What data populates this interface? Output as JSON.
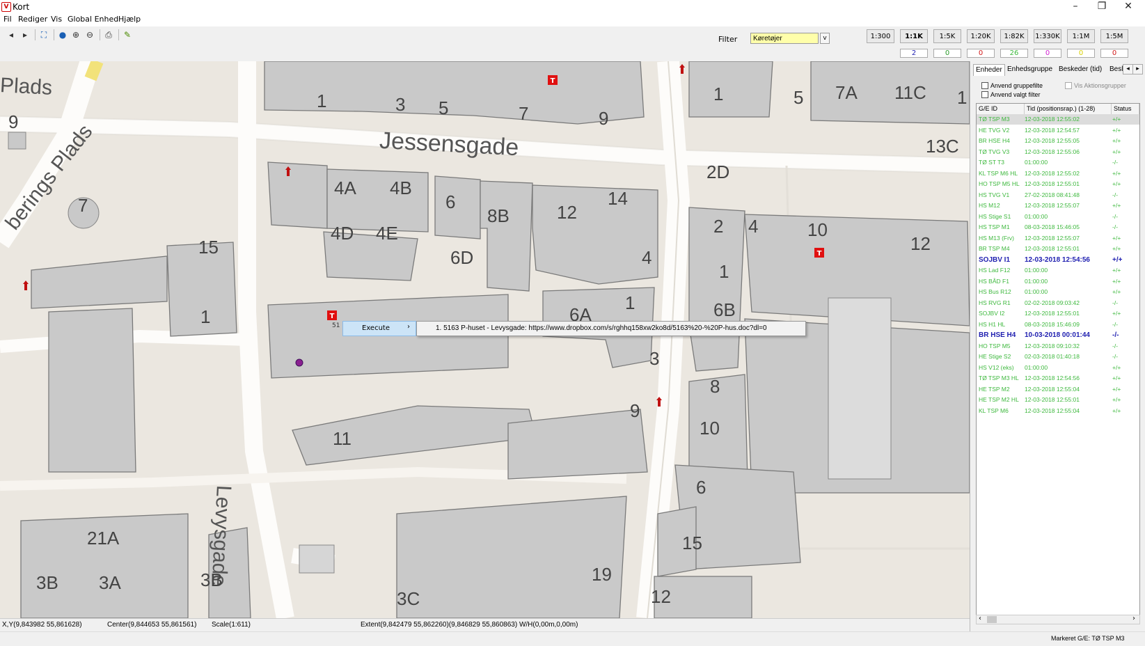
{
  "window": {
    "title": "Kort",
    "app_icon": "V",
    "controls": {
      "minimize": "–",
      "maximize": "❐",
      "close": "✕"
    }
  },
  "menu": [
    "Fil",
    "Rediger",
    "Vis",
    "Global Enhed",
    "Hjælp"
  ],
  "toolbar": {
    "icons": [
      "back-icon",
      "forward-icon",
      "layers-icon",
      "globe-icon",
      "zoom-in-icon",
      "zoom-out-icon",
      "print-icon",
      "ruler-icon"
    ],
    "glyphs": [
      "◂",
      "▸",
      "⛶",
      "●",
      "⊕",
      "⊖",
      "⎙",
      "✎"
    ]
  },
  "filter": {
    "label": "Filter",
    "value": "Køretøjer",
    "dropdown": "v"
  },
  "scales": [
    "1:300",
    "1:1K",
    "1:5K",
    "1:20K",
    "1:82K",
    "1:330K",
    "1:1M",
    "1:5M"
  ],
  "active_scale": "1:1K",
  "counts": [
    {
      "value": "2",
      "color": "#1f1fb0"
    },
    {
      "value": "0",
      "color": "#2a9a2a"
    },
    {
      "value": "0",
      "color": "#d01818"
    },
    {
      "value": "26",
      "color": "#3db83d"
    },
    {
      "value": "0",
      "color": "#d020d0"
    },
    {
      "value": "0",
      "color": "#d8d000"
    },
    {
      "value": "0",
      "color": "#d01818"
    }
  ],
  "map": {
    "streets": [
      "Jessensgade",
      "Levysgade",
      "berings Plads",
      "Plads"
    ],
    "house_numbers": [
      "1",
      "3",
      "5",
      "7",
      "9",
      "1",
      "5",
      "7A",
      "11C",
      "1",
      "13C",
      "9",
      "7",
      "2D",
      "4A",
      "4B",
      "6",
      "8B",
      "12",
      "14",
      "4D",
      "4E",
      "6D",
      "2",
      "4",
      "10",
      "12",
      "1",
      "15",
      "1",
      "4",
      "1",
      "6A",
      "6B",
      "3",
      "8",
      "9",
      "10",
      "11",
      "6",
      "15",
      "19",
      "12",
      "21A",
      "3B",
      "3A",
      "3B",
      "3C",
      "2"
    ],
    "marker_label": "T"
  },
  "context_menu": {
    "label": "Execute",
    "arrow": "›",
    "popup_prefix": "51",
    "submenu_item": "1. 5163 P-huset - Levysgade: https://www.dropbox.com/s/rghhq158xw2ko8d/5163%20-%20P-hus.doc?dl=0"
  },
  "status": {
    "xy": "X,Y(9,843982 55,861628)",
    "center": "Center(9,844653 55,861561)",
    "scale": "Scale(1:611)",
    "extent": "Extent(9,842479 55,862260)(9,846829 55,860863) W/H(0,00m,0,00m)"
  },
  "panel": {
    "tabs": [
      "Enheder",
      "Enhedsgruppe",
      "Beskeder (tid)",
      "Besl"
    ],
    "tab_nav": [
      "◂",
      "▸"
    ],
    "checkboxes": [
      "Anvend gruppefilte",
      "Anvend valgt filter"
    ],
    "aktion_checkbox": "Vis Aktionsgrupper",
    "columns": [
      "G/E ID",
      "Tid (positionsrap.) (1-28)",
      "Status"
    ],
    "rows": [
      {
        "id": "TØ TSP M3",
        "time": "12-03-2018 12:55:02",
        "status": "+/+",
        "style": "g",
        "selected": true
      },
      {
        "id": "HE TVG V2",
        "time": "12-03-2018 12:54:57",
        "status": "+/+",
        "style": "g"
      },
      {
        "id": "BR HSE H4",
        "time": "12-03-2018 12:55:05",
        "status": "+/+",
        "style": "g"
      },
      {
        "id": "TØ TVG V3",
        "time": "12-03-2018 12:55:06",
        "status": "+/+",
        "style": "g"
      },
      {
        "id": "TØ ST T3",
        "time": "01:00:00",
        "status": "-/-",
        "style": "g"
      },
      {
        "id": "KL TSP M6 HL",
        "time": "12-03-2018 12:55:02",
        "status": "+/+",
        "style": "g"
      },
      {
        "id": "HO TSP M5 HL",
        "time": "12-03-2018 12:55:01",
        "status": "+/+",
        "style": "g"
      },
      {
        "id": "HS TVG V1",
        "time": "27-02-2018 08:41:48",
        "status": "-/-",
        "style": "g"
      },
      {
        "id": "HS M12",
        "time": "12-03-2018 12:55:07",
        "status": "+/+",
        "style": "g"
      },
      {
        "id": "HS Stige S1",
        "time": "01:00:00",
        "status": "-/-",
        "style": "g"
      },
      {
        "id": "HS TSP M1",
        "time": "08-03-2018 15:46:05",
        "status": "-/-",
        "style": "g"
      },
      {
        "id": "HS M13 (Frv)",
        "time": "12-03-2018 12:55:07",
        "status": "+/+",
        "style": "g"
      },
      {
        "id": "BR TSP M4",
        "time": "12-03-2018 12:55:01",
        "status": "+/+",
        "style": "g"
      },
      {
        "id": "SOJBV I1",
        "time": "12-03-2018 12:54:56",
        "status": "+/+",
        "style": "b"
      },
      {
        "id": "HS Lad F12",
        "time": "01:00:00",
        "status": "+/+",
        "style": "g"
      },
      {
        "id": "HS BÅD F1",
        "time": "01:00:00",
        "status": "+/+",
        "style": "g"
      },
      {
        "id": "HS Bus R12",
        "time": "01:00:00",
        "status": "+/+",
        "style": "g"
      },
      {
        "id": "HS RVG R1",
        "time": "02-02-2018 09:03:42",
        "status": "-/-",
        "style": "g"
      },
      {
        "id": "SOJBV I2",
        "time": "12-03-2018 12:55:01",
        "status": "+/+",
        "style": "g"
      },
      {
        "id": "HS H1 HL",
        "time": "08-03-2018 15:46:09",
        "status": "-/-",
        "style": "g"
      },
      {
        "id": "BR HSE H4",
        "time": "10-03-2018 00:01:44",
        "status": "-/-",
        "style": "b"
      },
      {
        "id": "HO TSP M5",
        "time": "12-03-2018 09:10:32",
        "status": "-/-",
        "style": "g"
      },
      {
        "id": "HE Stige S2",
        "time": "02-03-2018 01:40:18",
        "status": "-/-",
        "style": "g"
      },
      {
        "id": "HS V12 (eks)",
        "time": "01:00:00",
        "status": "+/+",
        "style": "g"
      },
      {
        "id": "TØ TSP M3 HL",
        "time": "12-03-2018 12:54:56",
        "status": "+/+",
        "style": "g"
      },
      {
        "id": "HE TSP M2",
        "time": "12-03-2018 12:55:04",
        "status": "+/+",
        "style": "g"
      },
      {
        "id": "HE TSP M2 HL",
        "time": "12-03-2018 12:55:01",
        "status": "+/+",
        "style": "g"
      },
      {
        "id": "KL TSP M6",
        "time": "12-03-2018 12:55:04",
        "status": "+/+",
        "style": "g"
      }
    ],
    "scroll_left": "‹",
    "scroll_right": "›",
    "marked": "Markeret G/E: TØ TSP M3"
  }
}
